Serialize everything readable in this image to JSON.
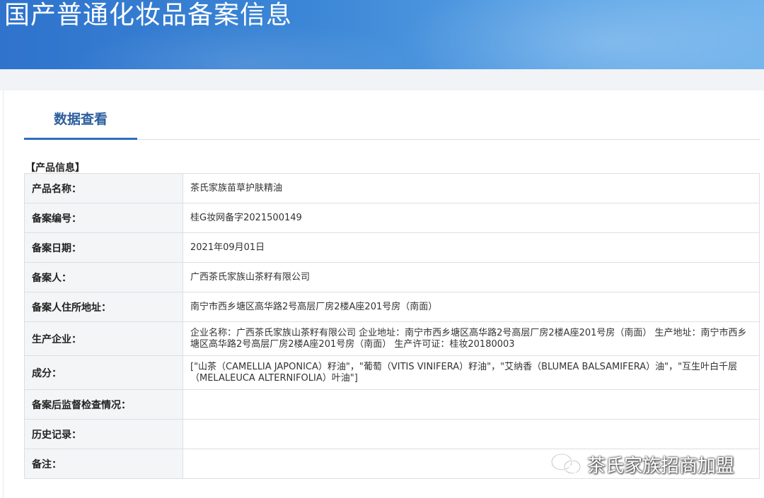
{
  "banner": {
    "title": "国产普通化妆品备案信息"
  },
  "tabs": [
    {
      "label": "数据查看",
      "active": true
    }
  ],
  "section": {
    "title": "【产品信息】"
  },
  "rows": [
    {
      "label": "产品名称：",
      "value": "茶氏家族苗草护肤精油"
    },
    {
      "label": "备案编号：",
      "value": "桂G妆网备字2021500149"
    },
    {
      "label": "备案日期：",
      "value": "2021年09月01日"
    },
    {
      "label": "备案人：",
      "value": "广西茶氏家族山茶籽有限公司"
    },
    {
      "label": "备案人住所地址：",
      "value": "南宁市西乡塘区高华路2号高层厂房2楼A座201号房（南面）"
    },
    {
      "label": "生产企业：",
      "value": "企业名称：广西茶氏家族山茶籽有限公司 企业地址：南宁市西乡塘区高华路2号高层厂房2楼A座201号房（南面） 生产地址：南宁市西乡塘区高华路2号高层厂房2楼A座201号房（南面） 生产许可证：桂妆20180003"
    },
    {
      "label": "成分：",
      "value": "[\"山茶（CAMELLIA JAPONICA）籽油\"，\"葡萄（VITIS VINIFERA）籽油\"，\"艾纳香（BLUMEA BALSAMIFERA）油\"，\"互生叶白千层（MELALEUCA ALTERNIFOLIA）叶油\"]"
    },
    {
      "label": "备案后监督检查情况：",
      "value": ""
    },
    {
      "label": "历史记录：",
      "value": ""
    },
    {
      "label": "备注：",
      "value": ""
    }
  ],
  "watermark": {
    "text": "茶氏家族招商加盟",
    "icon": "wechat-icon"
  },
  "colors": {
    "banner": "#3b86d6",
    "tab_text": "#2c5e9e",
    "tab_underline": "#2f6fbf",
    "label_bg": "#f4f5f7",
    "border": "#dcdfe3"
  }
}
